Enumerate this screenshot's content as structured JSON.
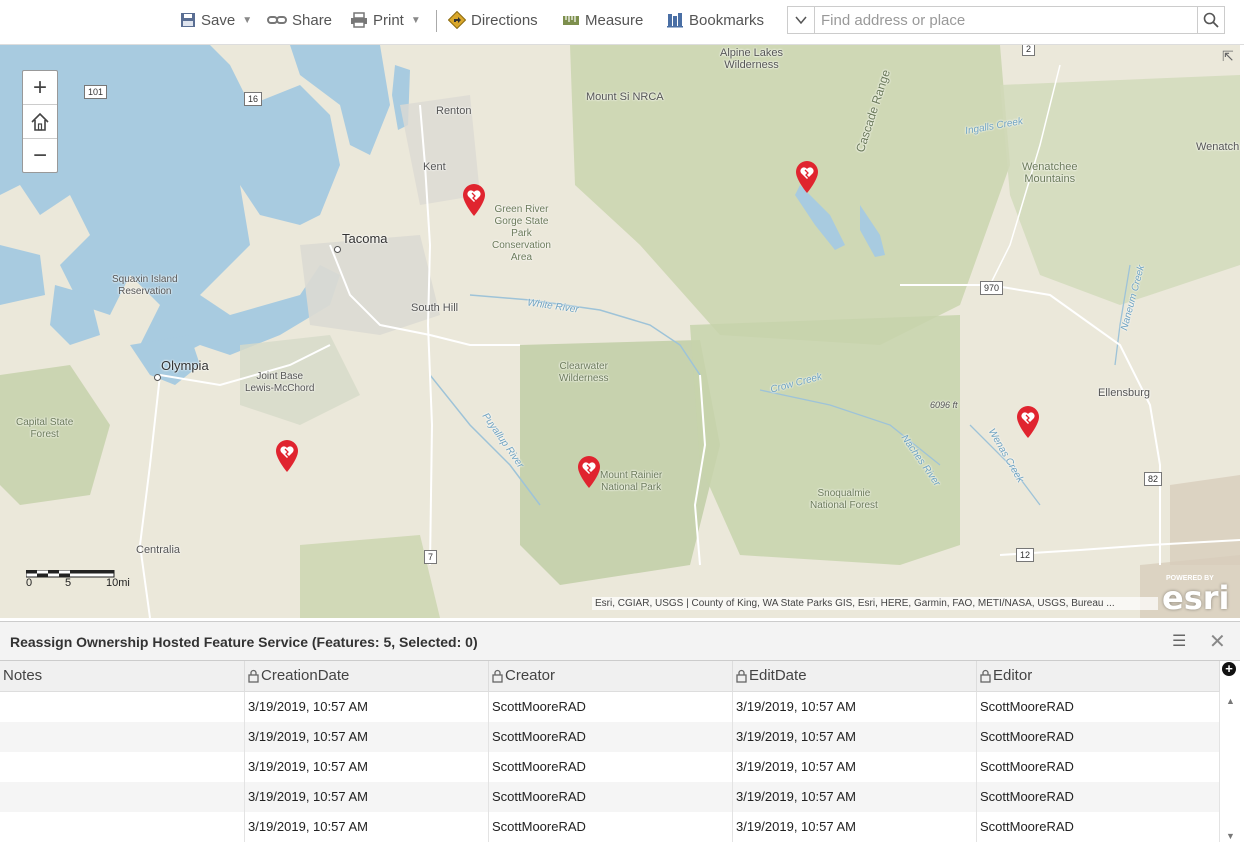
{
  "toolbar": {
    "save": "Save",
    "share": "Share",
    "print": "Print",
    "directions": "Directions",
    "measure": "Measure",
    "bookmarks": "Bookmarks",
    "search_placeholder": "Find address or place"
  },
  "map": {
    "labels": {
      "alpine": "Alpine Lakes\nWilderness",
      "cascade": "Cascade Range",
      "renton": "Renton",
      "mount_si": "Mount Si NRCA",
      "kent": "Kent",
      "ingalls": "Ingalls Creek",
      "wenatchee": "Wenatch",
      "wenatchee_mtns": "Wenatchee\nMountains",
      "green_river": "Green River\nGorge State\nPark\nConservation\nArea",
      "tacoma": "Tacoma",
      "squaxin": "Squaxin Island\nReservation",
      "south_hill": "South Hill",
      "white_river": "White River",
      "naneum": "Naneum Creek",
      "olympia": "Olympia",
      "jblm": "Joint Base\nLewis-McChord",
      "clearwater": "Clearwater\nWilderness",
      "crow_creek": "Crow Creek",
      "ellensburg": "Ellensburg",
      "peak": "6096 ft",
      "capital": "Capital State\nForest",
      "puyallup": "Puyallup River",
      "mt_rainier": "Mount Rainier\nNational Park",
      "naches": "Naches River",
      "wenas": "Wenas Creek",
      "snoqualmie": "Snoqualmie\nNational Forest",
      "centralia": "Centralia"
    },
    "shields": {
      "r101": "101",
      "r16": "16",
      "r2": "2",
      "r970": "970",
      "r82": "82",
      "r7": "7",
      "r12": "12"
    },
    "scale": {
      "s0": "0",
      "s5": "5",
      "s10": "10mi"
    },
    "attribution": "Esri, CGIAR, USGS | County of King, WA State Parks GIS, Esri, HERE, Garmin, FAO, METI/NASA, USGS, Bureau ...",
    "esri_powered": "POWERED BY",
    "esri_word": "esri"
  },
  "table": {
    "title": "Reassign Ownership Hosted Feature Service (Features: 5, Selected: 0)",
    "columns": [
      "Notes",
      "CreationDate",
      "Creator",
      "EditDate",
      "Editor"
    ],
    "rows": [
      {
        "notes": "",
        "creation": "3/19/2019, 10:57 AM",
        "creator": "ScottMooreRAD",
        "edit": "3/19/2019, 10:57 AM",
        "editor": "ScottMooreRAD"
      },
      {
        "notes": "",
        "creation": "3/19/2019, 10:57 AM",
        "creator": "ScottMooreRAD",
        "edit": "3/19/2019, 10:57 AM",
        "editor": "ScottMooreRAD"
      },
      {
        "notes": "",
        "creation": "3/19/2019, 10:57 AM",
        "creator": "ScottMooreRAD",
        "edit": "3/19/2019, 10:57 AM",
        "editor": "ScottMooreRAD"
      },
      {
        "notes": "",
        "creation": "3/19/2019, 10:57 AM",
        "creator": "ScottMooreRAD",
        "edit": "3/19/2019, 10:57 AM",
        "editor": "ScottMooreRAD"
      },
      {
        "notes": "",
        "creation": "3/19/2019, 10:57 AM",
        "creator": "ScottMooreRAD",
        "edit": "3/19/2019, 10:57 AM",
        "editor": "ScottMooreRAD"
      }
    ]
  },
  "colors": {
    "marker": "#e0242f",
    "water": "#a8cbe0",
    "forest": "#c9d6b0"
  }
}
